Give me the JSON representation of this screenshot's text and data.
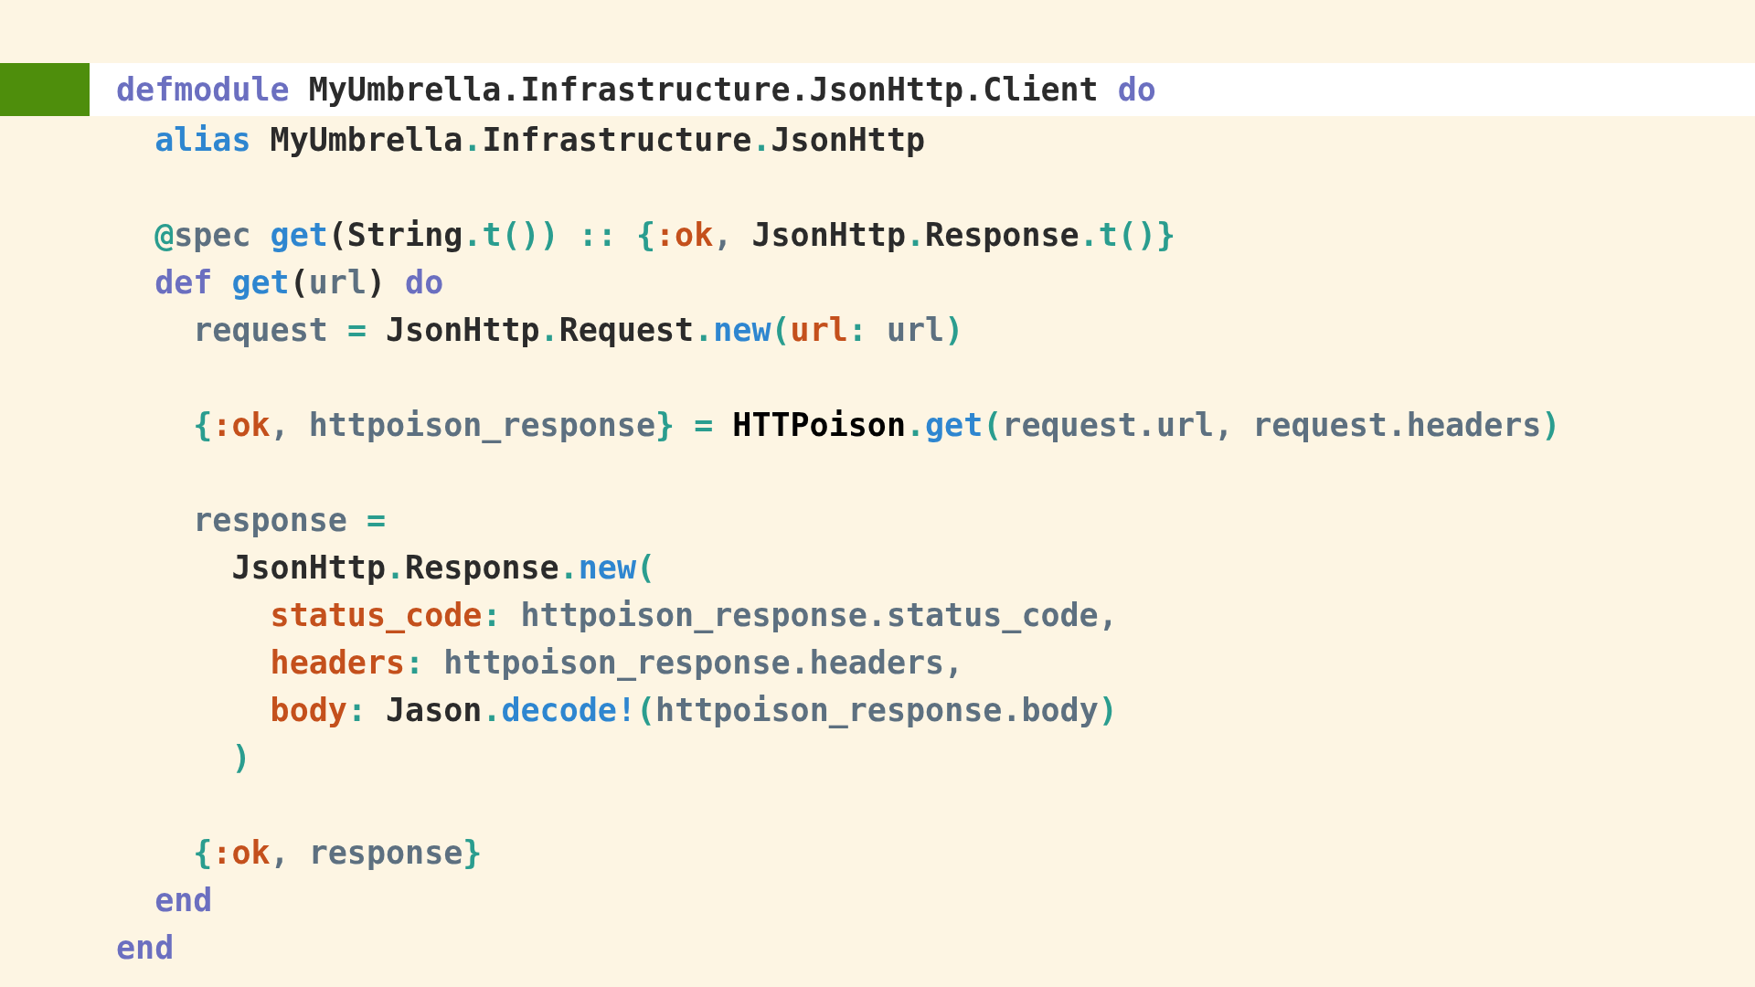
{
  "code_lines": [
    {
      "kind": "code",
      "selected": true,
      "tokens": [
        {
          "text": "defmodule",
          "kind": "kw"
        },
        {
          "text": " MyUmbrella.Infrastructure.JsonHttp.Client ",
          "kind": "mod"
        },
        {
          "text": "do",
          "kind": "kw"
        }
      ]
    },
    {
      "kind": "code",
      "selected": false,
      "tokens": [
        {
          "text": "  alias",
          "kind": "fn"
        },
        {
          "text": " MyUmbrella",
          "kind": "mod"
        },
        {
          "text": ".",
          "kind": "dot"
        },
        {
          "text": "Infrastructure",
          "kind": "mod"
        },
        {
          "text": ".",
          "kind": "dot"
        },
        {
          "text": "JsonHttp",
          "kind": "mod"
        }
      ]
    },
    {
      "kind": "blank",
      "selected": false
    },
    {
      "kind": "code",
      "selected": false,
      "tokens": [
        {
          "text": "  @",
          "kind": "dot"
        },
        {
          "text": "spec ",
          "kind": "var"
        },
        {
          "text": "get",
          "kind": "fn"
        },
        {
          "text": "(String",
          "kind": "mod"
        },
        {
          "text": ".",
          "kind": "dot"
        },
        {
          "text": "t()) :: {",
          "kind": "dot"
        },
        {
          "text": ":ok",
          "kind": "atom"
        },
        {
          "text": ", ",
          "kind": "var"
        },
        {
          "text": "JsonHttp",
          "kind": "mod"
        },
        {
          "text": ".",
          "kind": "dot"
        },
        {
          "text": "Response",
          "kind": "mod"
        },
        {
          "text": ".",
          "kind": "dot"
        },
        {
          "text": "t()}",
          "kind": "dot"
        }
      ]
    },
    {
      "kind": "code",
      "selected": false,
      "tokens": [
        {
          "text": "  def ",
          "kind": "kw"
        },
        {
          "text": "get",
          "kind": "fn"
        },
        {
          "text": "(",
          "kind": "mod"
        },
        {
          "text": "url",
          "kind": "var"
        },
        {
          "text": ") ",
          "kind": "mod"
        },
        {
          "text": "do",
          "kind": "kw"
        }
      ]
    },
    {
      "kind": "code",
      "selected": false,
      "tokens": [
        {
          "text": "    request ",
          "kind": "var"
        },
        {
          "text": "= ",
          "kind": "dot"
        },
        {
          "text": "JsonHttp",
          "kind": "mod"
        },
        {
          "text": ".",
          "kind": "dot"
        },
        {
          "text": "Request",
          "kind": "mod"
        },
        {
          "text": ".",
          "kind": "dot"
        },
        {
          "text": "new",
          "kind": "fn"
        },
        {
          "text": "(",
          "kind": "dot"
        },
        {
          "text": "url",
          "kind": "key"
        },
        {
          "text": ": ",
          "kind": "dot"
        },
        {
          "text": "url",
          "kind": "var"
        },
        {
          "text": ")",
          "kind": "dot"
        }
      ]
    },
    {
      "kind": "blank",
      "selected": false
    },
    {
      "kind": "code",
      "selected": false,
      "tokens": [
        {
          "text": "    {",
          "kind": "dot"
        },
        {
          "text": ":ok",
          "kind": "atom"
        },
        {
          "text": ", httpoison_response",
          "kind": "var"
        },
        {
          "text": "} = ",
          "kind": "dot"
        },
        {
          "text": "HTTPoison",
          "kind": "strong"
        },
        {
          "text": ".",
          "kind": "dot"
        },
        {
          "text": "get",
          "kind": "fn"
        },
        {
          "text": "(",
          "kind": "dot"
        },
        {
          "text": "request.url, request.headers",
          "kind": "var"
        },
        {
          "text": ")",
          "kind": "dot"
        }
      ]
    },
    {
      "kind": "blank",
      "selected": false
    },
    {
      "kind": "code",
      "selected": false,
      "tokens": [
        {
          "text": "    response ",
          "kind": "var"
        },
        {
          "text": "=",
          "kind": "dot"
        }
      ]
    },
    {
      "kind": "code",
      "selected": false,
      "tokens": [
        {
          "text": "      JsonHttp",
          "kind": "mod"
        },
        {
          "text": ".",
          "kind": "dot"
        },
        {
          "text": "Response",
          "kind": "mod"
        },
        {
          "text": ".",
          "kind": "dot"
        },
        {
          "text": "new",
          "kind": "fn"
        },
        {
          "text": "(",
          "kind": "dot"
        }
      ]
    },
    {
      "kind": "code",
      "selected": false,
      "tokens": [
        {
          "text": "        status_code",
          "kind": "key"
        },
        {
          "text": ": ",
          "kind": "dot"
        },
        {
          "text": "httpoison_response.status_code,",
          "kind": "var"
        }
      ]
    },
    {
      "kind": "code",
      "selected": false,
      "tokens": [
        {
          "text": "        headers",
          "kind": "key"
        },
        {
          "text": ": ",
          "kind": "dot"
        },
        {
          "text": "httpoison_response.headers,",
          "kind": "var"
        }
      ]
    },
    {
      "kind": "code",
      "selected": false,
      "tokens": [
        {
          "text": "        body",
          "kind": "key"
        },
        {
          "text": ": ",
          "kind": "dot"
        },
        {
          "text": "Jason",
          "kind": "mod"
        },
        {
          "text": ".",
          "kind": "dot"
        },
        {
          "text": "decode!",
          "kind": "fn"
        },
        {
          "text": "(",
          "kind": "dot"
        },
        {
          "text": "httpoison_response.body",
          "kind": "var"
        },
        {
          "text": ")",
          "kind": "dot"
        }
      ]
    },
    {
      "kind": "code",
      "selected": false,
      "tokens": [
        {
          "text": "      )",
          "kind": "dot"
        }
      ]
    },
    {
      "kind": "blank",
      "selected": false
    },
    {
      "kind": "code",
      "selected": false,
      "tokens": [
        {
          "text": "    {",
          "kind": "dot"
        },
        {
          "text": ":ok",
          "kind": "atom"
        },
        {
          "text": ", response",
          "kind": "var"
        },
        {
          "text": "}",
          "kind": "dot"
        }
      ]
    },
    {
      "kind": "code",
      "selected": false,
      "tokens": [
        {
          "text": "  end",
          "kind": "kw"
        }
      ]
    },
    {
      "kind": "code",
      "selected": false,
      "tokens": [
        {
          "text": "end",
          "kind": "kw"
        }
      ]
    }
  ]
}
